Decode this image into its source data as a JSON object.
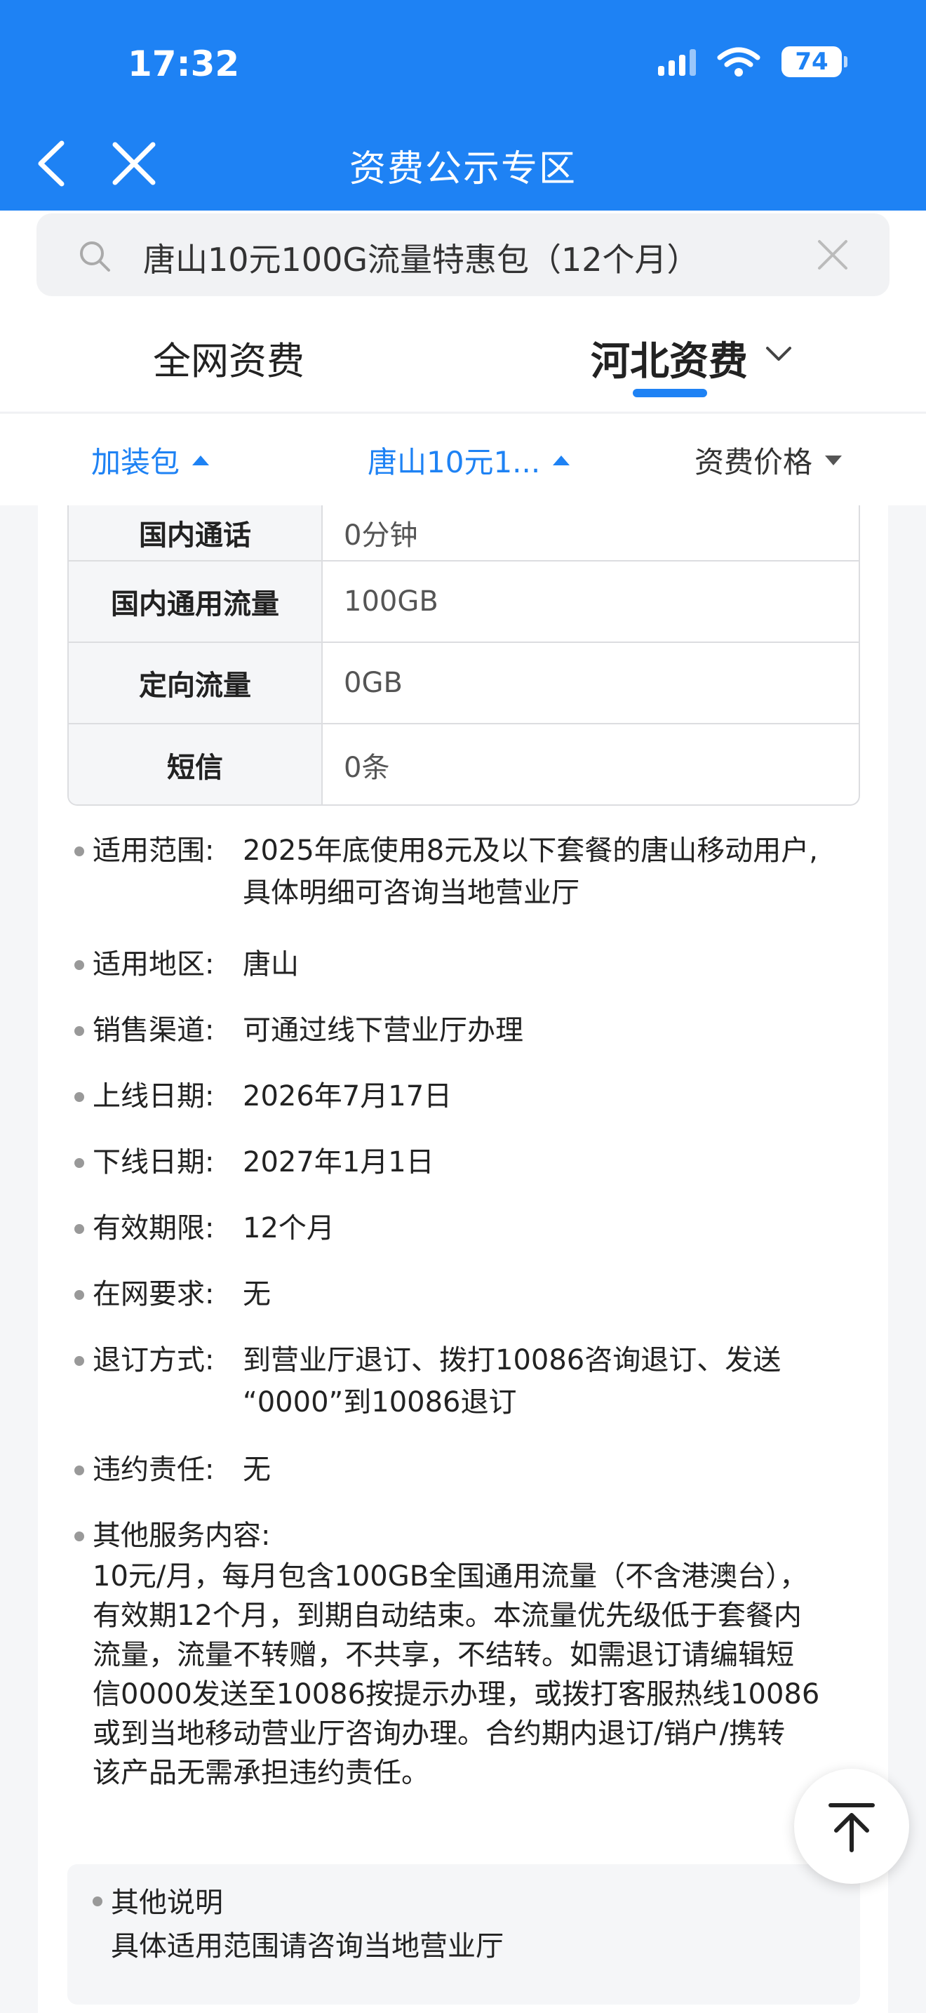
{
  "status_bar": {
    "time": "17:32",
    "battery": "74"
  },
  "header": {
    "title": "资费公示专区"
  },
  "search": {
    "value": "唐山10元100G流量特惠包（12个月）"
  },
  "tabs": {
    "national": "全网资费",
    "hebei": "河北资费"
  },
  "filters": {
    "category": "加装包",
    "product": "唐山10元1...",
    "price": "资费价格"
  },
  "spec_table": [
    {
      "label": "国内通话",
      "value": "0分钟"
    },
    {
      "label": "国内通用流量",
      "value": "100GB"
    },
    {
      "label": "定向流量",
      "value": "0GB"
    },
    {
      "label": "短信",
      "value": "0条"
    }
  ],
  "details": {
    "scope": {
      "label": "适用范围:",
      "line1": "2025年底使用8元及以下套餐的唐山移动用户,",
      "line2": "具体明细可咨询当地营业厅"
    },
    "region": {
      "label": "适用地区:",
      "value": "唐山"
    },
    "channel": {
      "label": "销售渠道:",
      "value": "可通过线下营业厅办理"
    },
    "online": {
      "label": "上线日期:",
      "value": "2026年7月17日"
    },
    "offline": {
      "label": "下线日期:",
      "value": "2027年1月1日"
    },
    "validity": {
      "label": "有效期限:",
      "value": "12个月"
    },
    "tenure": {
      "label": "在网要求:",
      "value": "无"
    },
    "unsubscribe": {
      "label": "退订方式:",
      "line1": "到营业厅退订、拨打10086咨询退订、发送",
      "line2": "“0000”到10086退订"
    },
    "penalty": {
      "label": "违约责任:",
      "value": "无"
    },
    "other": {
      "label": "其他服务内容:",
      "lines": [
        "10元/月，每月包含100GB全国通用流量（不含港澳台），",
        "有效期12个月，到期自动结束。本流量优先级低于套餐内",
        "流量，流量不转赠，不共享，不结转。如需退订请编辑短",
        "信0000发送至10086按提示办理，或拨打客服热线10086",
        "或到当地移动营业厅咨询办理。合约期内退订/销户/携转",
        "该产品无需承担违约责任。"
      ]
    }
  },
  "note": {
    "title": "其他说明",
    "text": "具体适用范围请咨询当地营业厅"
  },
  "colors": {
    "accent": "#1e82f4"
  }
}
